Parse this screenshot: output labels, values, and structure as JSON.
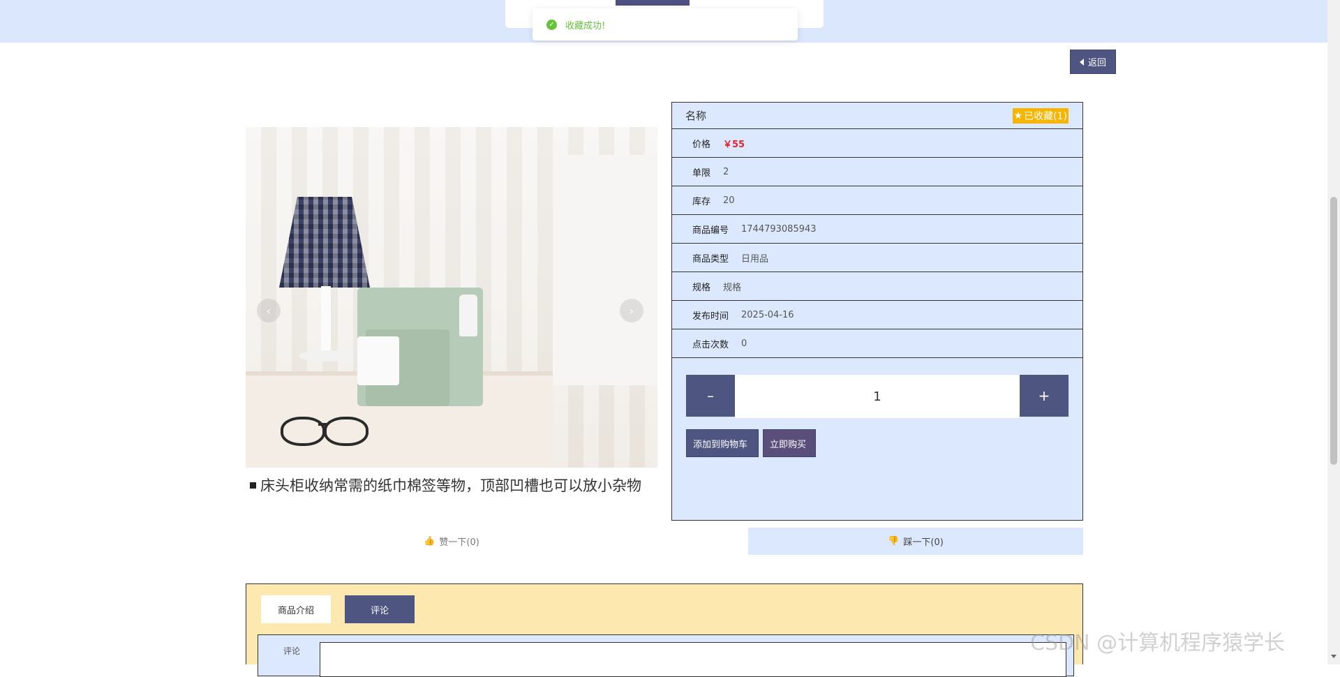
{
  "toast": {
    "message": "收藏成功!"
  },
  "back_button": {
    "label": "返回"
  },
  "carousel": {
    "caption": "床头柜收纳常需的纸巾棉签等物，顶部凹槽也可以放小杂物",
    "prev_glyph": "‹",
    "next_glyph": "›"
  },
  "product": {
    "name_label": "名称",
    "collect_badge": "已收藏(1)",
    "rows": [
      {
        "label": "价格",
        "value": "￥55"
      },
      {
        "label": "单限",
        "value": "2"
      },
      {
        "label": "库存",
        "value": "20"
      },
      {
        "label": "商品编号",
        "value": "1744793085943"
      },
      {
        "label": "商品类型",
        "value": "日用品"
      },
      {
        "label": "规格",
        "value": "规格"
      },
      {
        "label": "发布时间",
        "value": "2025-04-16"
      },
      {
        "label": "点击次数",
        "value": "0"
      }
    ],
    "quantity": "1",
    "minus": "–",
    "plus": "+",
    "add_to_cart": "添加到购物车",
    "buy_now": "立即购买"
  },
  "votes": {
    "up": "赞一下(0)",
    "down": "踩一下(0)"
  },
  "tabs": {
    "intro": "商品介绍",
    "comment": "评论",
    "comment_field_label": "评论"
  },
  "watermark": "CSDN @计算机程序猿学长",
  "colors": {
    "primary": "#4e5581",
    "panel": "#dce8fd",
    "accent": "#f7b500",
    "price": "#e3242b",
    "success": "#67c23a",
    "tabs_bg": "#fde9b0"
  }
}
